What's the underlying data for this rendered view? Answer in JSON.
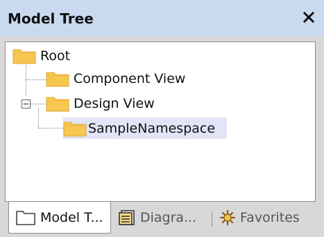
{
  "panel": {
    "title": "Model Tree",
    "close_glyph": "✕"
  },
  "tree": {
    "nodes": [
      {
        "label": "Root",
        "icon": "folder-icon"
      },
      {
        "label": "Component View",
        "icon": "folder-icon"
      },
      {
        "label": "Design View",
        "icon": "folder-icon",
        "expanded": true
      },
      {
        "label": "SampleNamespace",
        "icon": "folder-icon",
        "selected": true
      }
    ]
  },
  "tabs": [
    {
      "label": "Model T...",
      "icon": "folder-outline-icon",
      "active": true
    },
    {
      "label": "Diagra...",
      "icon": "diagram-tree-icon",
      "active": false
    },
    {
      "label": "Favorites",
      "icon": "favorites-star-icon",
      "active": false
    }
  ],
  "colors": {
    "titlebar": "#c9daf0",
    "folder": "#f7c751",
    "folder_dark": "#dcaa2f",
    "selection": "#e2e4f8",
    "panel_bg": "#d8d8d8"
  }
}
